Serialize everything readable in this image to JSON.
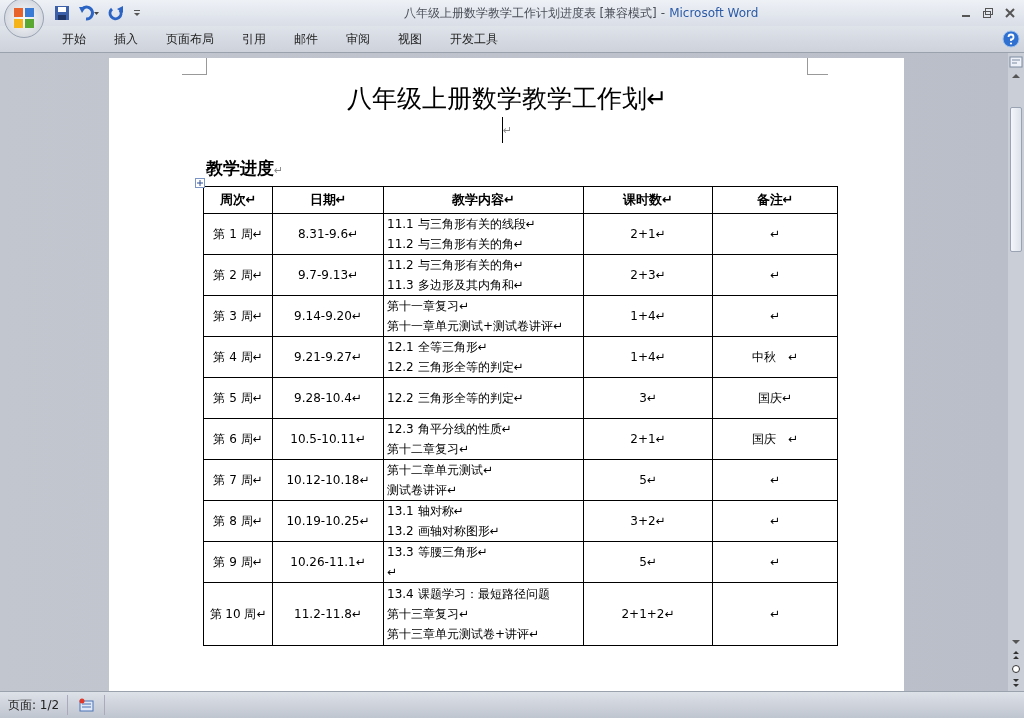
{
  "window": {
    "title": "八年级上册数学教学工作计划进度表 [兼容模式]",
    "separator": "-",
    "app_name": "Microsoft Word"
  },
  "ribbon_tabs": [
    "开始",
    "插入",
    "页面布局",
    "引用",
    "邮件",
    "审阅",
    "视图",
    "开发工具"
  ],
  "document": {
    "title": "八年级上册数学教学工作划↵",
    "blank_line": "↵",
    "heading": "教学进度",
    "heading_mark": "↵",
    "table": {
      "columns": [
        "周次↵",
        "日期↵",
        "教学内容↵",
        "课时数↵",
        "备注↵"
      ],
      "rows": [
        {
          "week": "第 1 周↵",
          "date": "8.31-9.6↵",
          "content": [
            "11.1 与三角形有关的线段↵",
            "11.2 与三角形有关的角↵"
          ],
          "hours": "2+1↵",
          "note": "↵"
        },
        {
          "week": "第 2 周↵",
          "date": "9.7-9.13↵",
          "content": [
            "11.2 与三角形有关的角↵",
            "11.3 多边形及其内角和↵"
          ],
          "hours": "2+3↵",
          "note": "↵"
        },
        {
          "week": "第 3 周↵",
          "date": "9.14-9.20↵",
          "content": [
            "第十一章复习↵",
            "第十一章单元测试+测试卷讲评↵"
          ],
          "hours": "1+4↵",
          "note": "↵"
        },
        {
          "week": "第 4 周↵",
          "date": "9.21-9.27↵",
          "content": [
            "12.1 全等三角形↵",
            "12.2 三角形全等的判定↵"
          ],
          "hours": "1+4↵",
          "note": "中秋　↵"
        },
        {
          "week": "第 5 周↵",
          "date": "9.28-10.4↵",
          "content": [
            "12.2 三角形全等的判定↵"
          ],
          "hours": "3↵",
          "note": "国庆↵"
        },
        {
          "week": "第 6 周↵",
          "date": "10.5-10.11↵",
          "content": [
            "12.3 角平分线的性质↵",
            "第十二章复习↵"
          ],
          "hours": "2+1↵",
          "note": "国庆　↵"
        },
        {
          "week": "第 7 周↵",
          "date": "10.12-10.18↵",
          "content": [
            "第十二章单元测试↵",
            "测试卷讲评↵"
          ],
          "hours": "5↵",
          "note": "↵"
        },
        {
          "week": "第 8 周↵",
          "date": "10.19-10.25↵",
          "content": [
            "13.1 轴对称↵",
            "13.2 画轴对称图形↵"
          ],
          "hours": "3+2↵",
          "note": "↵"
        },
        {
          "week": "第 9 周↵",
          "date": "10.26-11.1↵",
          "content": [
            "13.3 等腰三角形↵",
            "↵"
          ],
          "hours": "5↵",
          "note": "↵"
        },
        {
          "week": "第 10 周↵",
          "date": "11.2-11.8↵",
          "content": [
            "13.4 课题学习：最短路径问题",
            "第十三章复习↵",
            "第十三章单元测试卷+讲评↵"
          ],
          "hours": "2+1+2↵",
          "note": "↵"
        }
      ]
    }
  },
  "status_bar": {
    "page": "页面: 1/2"
  }
}
